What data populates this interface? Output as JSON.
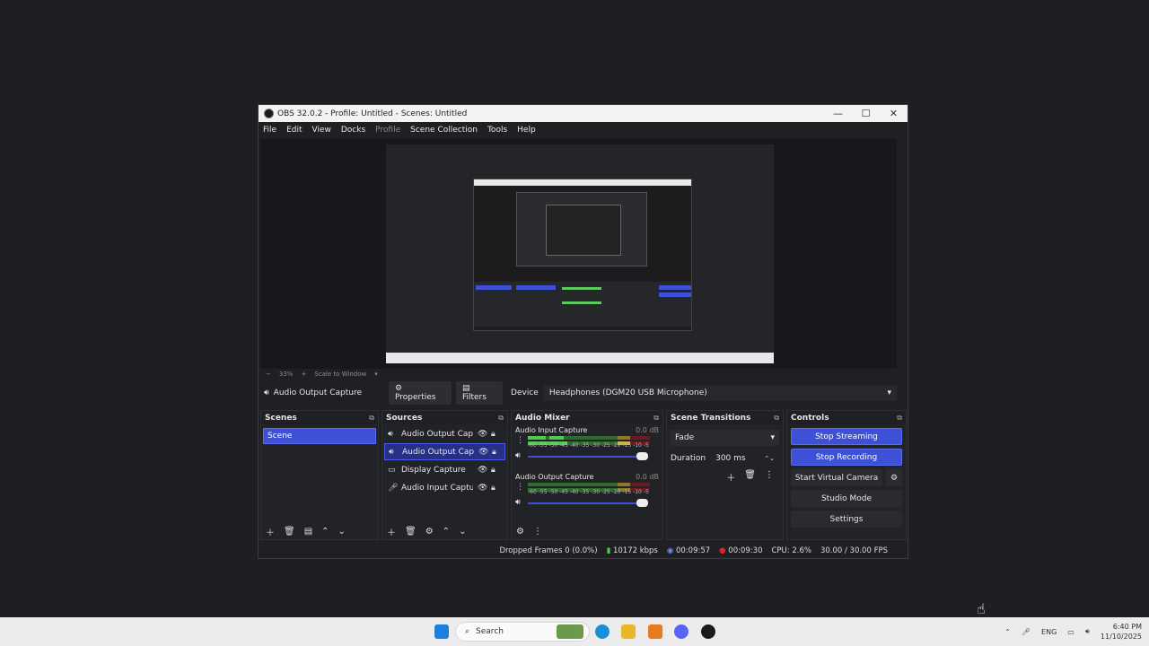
{
  "window": {
    "title": "OBS 32.0.2 - Profile: Untitled - Scenes: Untitled",
    "minimize": "—",
    "maximize": "☐",
    "close": "✕"
  },
  "menu": {
    "items": [
      "File",
      "Edit",
      "View",
      "Docks",
      "Profile",
      "Scene Collection",
      "Tools",
      "Help"
    ]
  },
  "zoom": {
    "minus": "−",
    "value": "33%",
    "plus": "+",
    "mode": "Scale to Window",
    "caret": "▾"
  },
  "properties": {
    "source_name": "Audio Output Capture",
    "properties_label": "Properties",
    "filters_label": "Filters",
    "device_label": "Device",
    "device_value": "Headphones (DGM20 USB Microphone)"
  },
  "scenes": {
    "title": "Scenes",
    "items": [
      "Scene"
    ]
  },
  "sources": {
    "title": "Sources",
    "items": [
      "Audio Output Captu",
      "Audio Output Captu",
      "Display Capture",
      "Audio Input Captur"
    ]
  },
  "mixer": {
    "title": "Audio Mixer",
    "channels": [
      {
        "name": "Audio Input Capture",
        "db": "0.0 dB",
        "ticks": "-60 -55 -50 -45 -40 -35 -30 -25 -20 -15 -10 -5 0"
      },
      {
        "name": "Audio Output Capture",
        "db": "0.0 dB",
        "ticks": "-60 -55 -50 -45 -40 -35 -30 -25 -20 -15 -10 -5 0"
      }
    ]
  },
  "transitions": {
    "title": "Scene Transitions",
    "type": "Fade",
    "duration_label": "Duration",
    "duration_value": "300 ms"
  },
  "controls": {
    "title": "Controls",
    "stop_streaming": "Stop Streaming",
    "stop_recording": "Stop Recording",
    "start_virtual_camera": "Start Virtual Camera",
    "studio_mode": "Studio Mode",
    "settings": "Settings"
  },
  "status": {
    "dropped_frames": "Dropped Frames 0 (0.0%)",
    "bitrate": "10172 kbps",
    "stream_time": "00:09:57",
    "rec_time": "00:09:30",
    "cpu": "CPU: 2.6%",
    "fps": "30.00 / 30.00 FPS"
  },
  "taskbar": {
    "search_placeholder": "Search",
    "language": "ENG",
    "time": "6:40 PM",
    "date": "11/10/2025"
  },
  "colors": {
    "accent": "#3e51d6",
    "recording": "#e0202a",
    "meter_green": "#4fc94f",
    "meter_yellow": "#c9b43a",
    "meter_red": "#a8202c"
  }
}
